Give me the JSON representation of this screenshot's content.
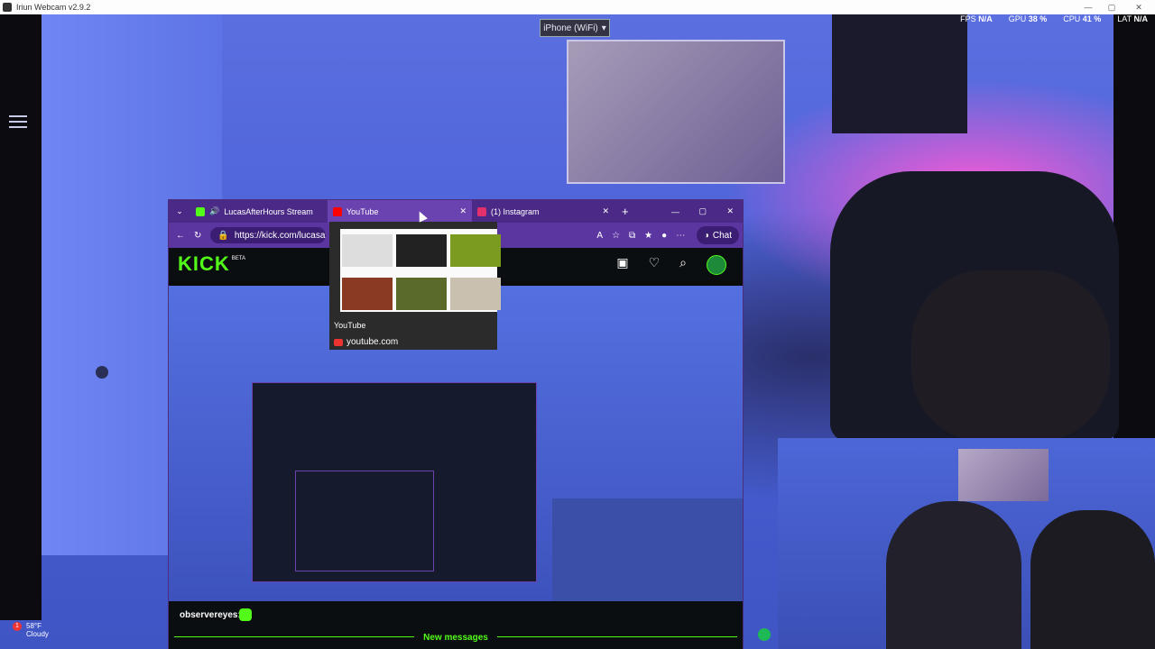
{
  "app": {
    "title": "Iriun Webcam v2.9.2",
    "minimize_icon": "minimize-icon",
    "maximize_icon": "maximize-icon",
    "close_icon": "close-icon"
  },
  "source_select": {
    "selected": "iPhone (WiFi)"
  },
  "stats": {
    "fps_label": "FPS",
    "fps_value": "N/A",
    "gpu_label": "GPU",
    "gpu_value": "38 %",
    "cpu_label": "CPU",
    "cpu_value": "41 %",
    "lat_label": "LAT",
    "lat_value": "N/A"
  },
  "browser": {
    "tabs": [
      {
        "label": "LucasAfterHours Stream - W",
        "icon": "kick-icon",
        "audio": true,
        "color": "#53fc18"
      },
      {
        "label": "YouTube",
        "icon": "youtube-icon",
        "color": "#ff0000",
        "active": true
      },
      {
        "label": "(1) Instagram",
        "icon": "instagram-icon",
        "color": "#e1306c"
      }
    ],
    "url": "https://kick.com/lucasafter",
    "chat_label": "Chat"
  },
  "kick": {
    "logo": "KICK",
    "beta": "BETA",
    "chat_user": "observereyes:",
    "new_messages": "New messages"
  },
  "preview": {
    "title": "YouTube",
    "domain": "youtube.com"
  },
  "weather": {
    "alert": "1",
    "temp": "58°F",
    "condition": "Cloudy"
  }
}
